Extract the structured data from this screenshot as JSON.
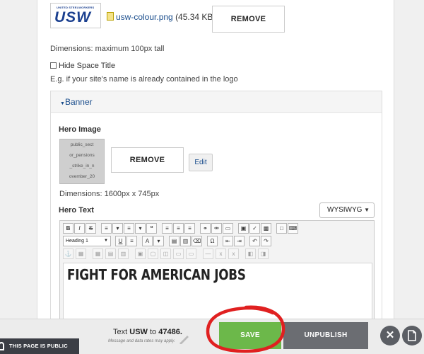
{
  "logo": {
    "top_text": "UNITED STEELWORKERS",
    "main_text": "USW"
  },
  "file": {
    "name": "usw-colour.png",
    "size": "(45.34 KB)",
    "remove_label": "REMOVE"
  },
  "dimensions_note": "Dimensions: maximum 100px tall",
  "hide_title": {
    "label": "Hide Space Title",
    "checked": false
  },
  "hint": "E.g. if your site's name is already contained in the logo",
  "banner": {
    "section_label": "Banner",
    "hero_image_label": "Hero Image",
    "thumbnail_lines": [
      "public_sect",
      "or_pensions",
      "_strike_in_n",
      "ovember_20"
    ],
    "remove_label": "REMOVE",
    "edit_label": "Edit",
    "dimensions": "Dimensions: 1600px x 745px",
    "hero_text_label": "Hero Text",
    "editor_mode": "WYSIWYG",
    "heading_select": "Heading 1",
    "content": "FIGHT FOR AMERICAN JOBS"
  },
  "toolbar": {
    "row1": [
      {
        "icon": "bold-icon",
        "glyph": "B"
      },
      {
        "icon": "italic-icon",
        "glyph": "I"
      },
      {
        "icon": "strike-icon",
        "glyph": "S"
      },
      {
        "icon": "bullet-list-icon",
        "glyph": "≡"
      },
      {
        "icon": "dropdown-icon",
        "glyph": "▾"
      },
      {
        "icon": "numbered-list-icon",
        "glyph": "≡"
      },
      {
        "icon": "dropdown-icon",
        "glyph": "▾"
      },
      {
        "icon": "blockquote-icon",
        "glyph": "❝"
      },
      {
        "icon": "align-left-icon",
        "glyph": "≡"
      },
      {
        "icon": "align-center-icon",
        "glyph": "≡"
      },
      {
        "icon": "align-right-icon",
        "glyph": "≡"
      },
      {
        "icon": "link-icon",
        "glyph": "⚭"
      },
      {
        "icon": "unlink-icon",
        "glyph": "⚮"
      },
      {
        "icon": "page-break-icon",
        "glyph": "▭"
      },
      {
        "icon": "image-icon",
        "glyph": "▣"
      },
      {
        "icon": "spellcheck-icon",
        "glyph": "✓"
      },
      {
        "icon": "media-icon",
        "glyph": "▩"
      },
      {
        "icon": "fullscreen-icon",
        "glyph": "□"
      },
      {
        "icon": "keyboard-icon",
        "glyph": "⌨"
      }
    ],
    "row2": [
      {
        "icon": "underline-icon",
        "glyph": "U"
      },
      {
        "icon": "justify-icon",
        "glyph": "≡"
      },
      {
        "icon": "font-color-icon",
        "glyph": "A"
      },
      {
        "icon": "dropdown-icon",
        "glyph": "▾"
      },
      {
        "icon": "paste-icon",
        "glyph": "▤"
      },
      {
        "icon": "paste-text-icon",
        "glyph": "▥"
      },
      {
        "icon": "remove-format-icon",
        "glyph": "⌫"
      },
      {
        "icon": "special-char-icon",
        "glyph": "Ω"
      },
      {
        "icon": "outdent-icon",
        "glyph": "⇤"
      },
      {
        "icon": "indent-icon",
        "glyph": "⇥"
      },
      {
        "icon": "undo-icon",
        "glyph": "↶"
      },
      {
        "icon": "redo-icon",
        "glyph": "↷"
      }
    ],
    "row3": [
      {
        "icon": "anchor-icon",
        "glyph": "⚓"
      },
      {
        "icon": "template-icon",
        "glyph": "▦"
      },
      {
        "icon": "table-icon",
        "glyph": "▦"
      },
      {
        "icon": "table-row-icon",
        "glyph": "▤"
      },
      {
        "icon": "table-col-icon",
        "glyph": "▥"
      },
      {
        "icon": "merge-cells-icon",
        "glyph": "▣"
      },
      {
        "icon": "split-cells-icon",
        "glyph": "▢"
      },
      {
        "icon": "cell-props-icon",
        "glyph": "◫"
      },
      {
        "icon": "delete-row-icon",
        "glyph": "▭"
      },
      {
        "icon": "insert-row-icon",
        "glyph": "▭"
      },
      {
        "icon": "hr-icon",
        "glyph": "—"
      },
      {
        "icon": "sub-icon",
        "glyph": "x"
      },
      {
        "icon": "sup-icon",
        "glyph": "x"
      },
      {
        "icon": "source-icon",
        "glyph": "◧"
      },
      {
        "icon": "source2-icon",
        "glyph": "◨"
      }
    ]
  },
  "bottom": {
    "public_status": "THIS PAGE IS PUBLIC",
    "text_prefix": "Text",
    "text_keyword": "USW",
    "text_mid": "to",
    "text_number": "47486.",
    "rates_note": "Message and data rates may apply.",
    "save_label": "SAVE",
    "unpublish_label": "UNPUBLISH"
  },
  "colors": {
    "save": "#6cb84a",
    "unpublish": "#6b6d72",
    "annotation": "#e02020",
    "link": "#1a4d8c"
  }
}
